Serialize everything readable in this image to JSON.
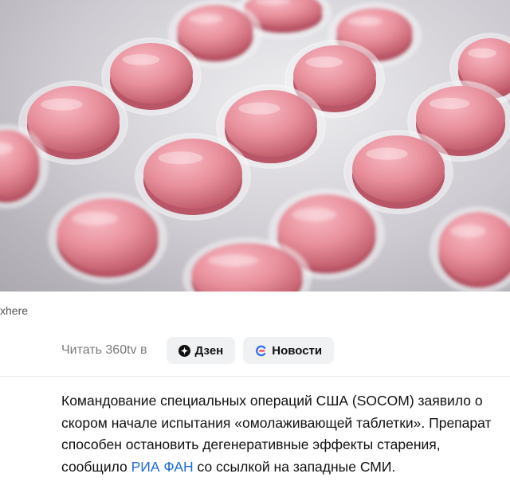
{
  "photo": {
    "subject": "pink-pills-blister-pack"
  },
  "caption": {
    "text": "xhere"
  },
  "read_in": {
    "label": "Читать 360tv в",
    "buttons": [
      {
        "label": "Дзен",
        "icon": "dzen-icon"
      },
      {
        "label": "Новости",
        "icon": "news-icon"
      }
    ]
  },
  "article": {
    "text_before_link": "Командование специальных операций США (SOCOM) заявило о скором начале испытания «омолаживающей таблетки». Препарат способен остановить дегенеративные эффекты старения, сообщило ",
    "link_text": "РИА ФАН",
    "text_after_link": " со ссылкой на западные СМИ."
  },
  "colors": {
    "link": "#1f6bd6",
    "pill_bg": "#f0f1f3",
    "tablet": "#e8909c"
  }
}
